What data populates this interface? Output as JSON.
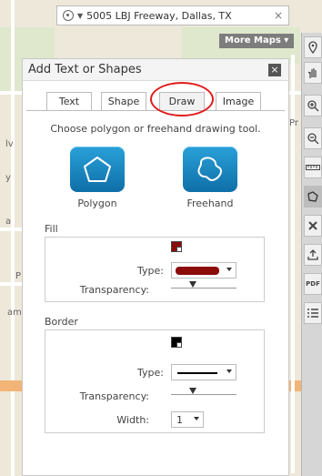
{
  "address_bar": {
    "value": "5005 LBJ Freeway, Dallas, TX",
    "clear_label": "×"
  },
  "more_maps": {
    "label": "More Maps ▾"
  },
  "map_labels": [
    "lv",
    "y",
    "a",
    "P",
    "am",
    "Pr"
  ],
  "toolbar": {
    "icons": [
      "pin-icon",
      "pan-hand-icon",
      "zoom-in-icon",
      "zoom-out-icon",
      "measure-icon",
      "draw-icon",
      "clear-icon",
      "share-icon",
      "pdf-icon",
      "legend-icon"
    ],
    "pdf_label": "PDF"
  },
  "dialog": {
    "title": "Add Text or Shapes",
    "close_label": "×",
    "tabs": [
      {
        "label": "Text"
      },
      {
        "label": "Shape"
      },
      {
        "label": "Draw"
      },
      {
        "label": "Image"
      }
    ],
    "active_tab": "Draw",
    "instruction": "Choose polygon or freehand drawing tool.",
    "tools": [
      {
        "label": "Polygon"
      },
      {
        "label": "Freehand"
      }
    ],
    "fill": {
      "title": "Fill",
      "color": "#8b0a0a",
      "type_label": "Type:",
      "transparency_label": "Transparency:",
      "transparency_value": 0.35
    },
    "border": {
      "title": "Border",
      "color": "#000000",
      "type_label": "Type:",
      "transparency_label": "Transparency:",
      "transparency_value": 0.35,
      "width_label": "Width:",
      "width_value": "1"
    }
  },
  "colors": {
    "accent_circle": "#e11b1b",
    "tool_blue": "#1a86c4"
  }
}
